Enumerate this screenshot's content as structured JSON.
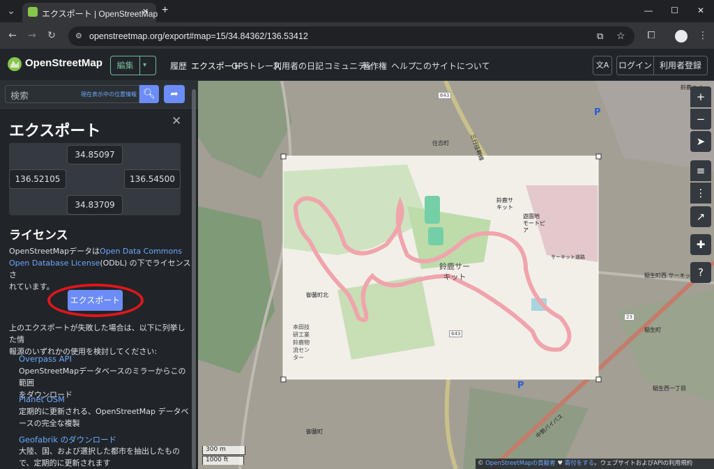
{
  "browser": {
    "tab_title": "エクスポート | OpenStreetMap",
    "new_tab": "+",
    "url": "openstreetmap.org/export#map=15/34.84362/136.53412",
    "window_controls": {
      "minimize": "—",
      "maximize": "☐",
      "close": "✕"
    }
  },
  "header": {
    "brand": "OpenStreetMap",
    "edit_label": "編集",
    "nav": [
      "履歴",
      "エクスポート",
      "GPSトレース",
      "利用者の日記",
      "コミュニティ",
      "著作権",
      "ヘルプ",
      "このサイトについて"
    ],
    "login": "ログイン",
    "signup": "利用者登録"
  },
  "search": {
    "placeholder": "検索",
    "where_am_i": "現在表示中の位置情報"
  },
  "export": {
    "title": "エクスポート",
    "max_lat": "34.85097",
    "min_lon": "136.52105",
    "max_lon": "136.54500",
    "min_lat": "34.83709",
    "license_heading": "ライセンス",
    "license_pre": "OpenStreetMapデータは",
    "license_link": "Open Data Commons Open Database License",
    "license_post1": "(ODbL) の下でライセンスさ",
    "license_post2": "れています。",
    "export_button": "エクスポート",
    "fail_text1": "上のエクスポートが失敗した場合は、以下に列挙した情",
    "fail_text2": "報源のいずれかの使用を検討してください:",
    "sources": [
      {
        "name": "Overpass API",
        "desc1": "OpenStreetMapデータベースのミラーからこの範囲",
        "desc2": "をダウンロード"
      },
      {
        "name": "Planet OSM",
        "desc1": "定期的に更新される、OpenStreetMap データベ",
        "desc2": "ースの完全な複製"
      },
      {
        "name": "Geofabrik のダウンロード",
        "desc1": "大陸、国、および選択した都市を抽出したもの",
        "desc2": "で、定期的に更新されます"
      }
    ]
  },
  "map": {
    "labels": {
      "suzuka_circuit": [
        "鈴鹿サー",
        "キット"
      ],
      "suzuka_circuit_small": [
        "鈴鹿サ",
        "キット"
      ],
      "amusement": [
        "遊園地",
        "モートピ",
        "ア"
      ],
      "honda": [
        "本田技",
        "研工業",
        "鈴鹿物",
        "流セン",
        "ター"
      ],
      "misono_north": "御薗町北",
      "misono": "御薗町",
      "sumiyoshi": "住吉町",
      "inazo_nishi": "稲生町西 サーキット道路",
      "inazo": "稲生町",
      "inazo_nishi_1": "稲生西一丁目",
      "route_643": "643",
      "route_23": "23",
      "mie_pref": "三行往幹線",
      "chubu_bypass": "中勢バイパス",
      "suzuka_hi": "鈴鹿ハイ",
      "circuit_road": "サーキット道路",
      "parking": "P"
    },
    "scale_m": "300 m",
    "scale_ft": "1000 ft",
    "attribution_pre": "© ",
    "attribution_osm": "OpenStreetMapの貢献者",
    "attribution_heart": " ♥ ",
    "attribution_donate": "寄付をする",
    "attribution_rest": "。ウェブサイトおよびAPIの利用規約",
    "controls": [
      "+",
      "−",
      "➤",
      "≡",
      "⋮",
      "↗",
      "✚",
      "?"
    ]
  },
  "colors": {
    "accent": "#6ea8fe",
    "export_button": "#6c8cf8",
    "highlight_ring": "#e0161b",
    "osm_green": "#86c64c"
  }
}
